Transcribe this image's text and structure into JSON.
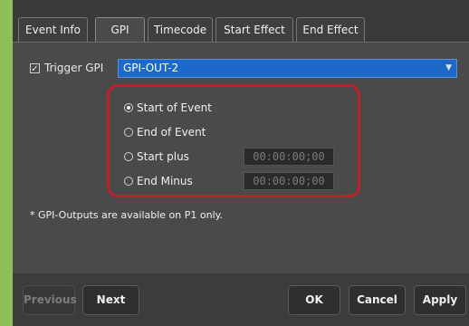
{
  "tabs": [
    {
      "label": "Event Info",
      "active": false
    },
    {
      "label": "GPI",
      "active": true
    },
    {
      "label": "Timecode",
      "active": false
    },
    {
      "label": "Start Effect",
      "active": false
    },
    {
      "label": "End Effect",
      "active": false
    }
  ],
  "trigger": {
    "checkbox_label": "Trigger GPI",
    "checked": true,
    "selected_output": "GPI-OUT-2"
  },
  "options": [
    {
      "label": "Start of Event",
      "selected": true
    },
    {
      "label": "End of Event",
      "selected": false
    },
    {
      "label": "Start plus",
      "selected": false,
      "timecode": "00:00:00;00"
    },
    {
      "label": "End Minus",
      "selected": false,
      "timecode": "00:00:00;00"
    }
  ],
  "note": "* GPI-Outputs are available on P1 only.",
  "footer": {
    "previous_label": "Previous",
    "next_label": "Next",
    "ok_label": "OK",
    "cancel_label": "Cancel",
    "apply_label": "Apply"
  },
  "colors": {
    "accent_blue": "#1d69c9",
    "highlight_red": "#c0202c",
    "background_green": "#8fbf5a"
  }
}
